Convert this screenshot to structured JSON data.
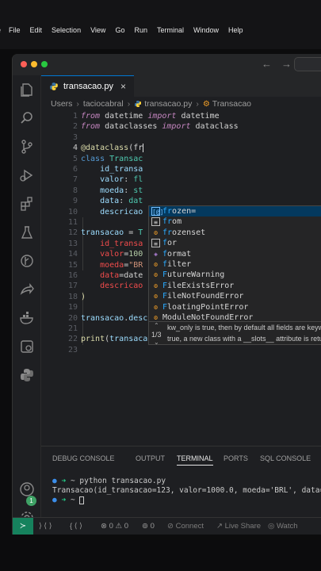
{
  "menubar": {
    "items": [
      "e",
      "File",
      "Edit",
      "Selection",
      "View",
      "Go",
      "Run",
      "Terminal",
      "Window",
      "Help"
    ]
  },
  "tab": {
    "label": "transacao.py",
    "close": "×"
  },
  "breadcrumb": [
    "Users",
    "taciocabral",
    "transacao.py",
    "Transacao"
  ],
  "editor": {
    "line_numbers": [
      "1",
      "2",
      "3",
      "4",
      "5",
      "6",
      "7",
      "8",
      "9",
      "10",
      "11",
      "12",
      "13",
      "14",
      "15",
      "16",
      "17",
      "18",
      "19",
      "20",
      "21",
      "22",
      "23"
    ],
    "current_line": "4"
  },
  "suggestions": {
    "items": [
      {
        "icon": "field",
        "label": "frozen="
      },
      {
        "icon": "keyword",
        "label": "from"
      },
      {
        "icon": "class",
        "label": "frozenset"
      },
      {
        "icon": "keyword",
        "label": "for"
      },
      {
        "icon": "function",
        "label": "format"
      },
      {
        "icon": "class",
        "label": "filter"
      },
      {
        "icon": "class",
        "label": "FutureWarning"
      },
      {
        "icon": "class",
        "label": "FileExistsError"
      },
      {
        "icon": "class",
        "label": "FileNotFoundError"
      },
      {
        "icon": "class",
        "label": "FloatingPointError"
      },
      {
        "icon": "class",
        "label": "ModuleNotFoundError"
      }
    ]
  },
  "hover_doc": {
    "line1": "kw_only is true, then by default all fields are keyw",
    "line2": "true, a new class with a __slots__ attribute is retu",
    "counter": "1/3"
  },
  "panel": {
    "tabs": [
      "DEBUG CONSOLE",
      "OUTPUT",
      "TERMINAL",
      "PORTS",
      "SQL CONSOLE"
    ],
    "active_tab": "TERMINAL",
    "terminal": {
      "cmd_prompt": "~",
      "cmd": "python transacao.py",
      "output": "Transacao(id_transacao=123, valor=1000.0, moeda='BRL', data=datetime",
      "prompt2": "~"
    }
  },
  "statusbar": {
    "errors": "0",
    "warnings": "0",
    "info": "0",
    "connect": "Connect",
    "liveshare": "Live Share",
    "watch": "Watch"
  },
  "activity": {
    "badge": "1"
  }
}
